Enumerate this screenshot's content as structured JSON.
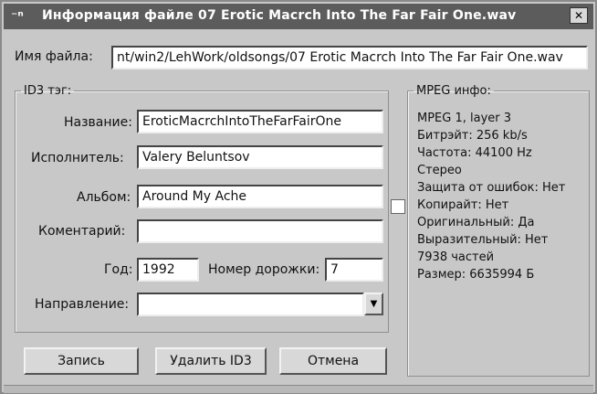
{
  "window": {
    "title": "Информация   файле   07 Erotic Macrch Into The Far Fair One.wav",
    "menu_icon": "menu-glyph",
    "close_icon": "close-icon"
  },
  "file": {
    "label": "Имя файла:",
    "value": "nt/win2/LehWork/oldsongs/07 Erotic Macrch Into The Far Fair One.wav"
  },
  "id3": {
    "legend": "ID3 тэг:",
    "title_label": "Название:",
    "title_value": "EroticMacrchIntoTheFarFairOne",
    "artist_label": "Исполнитель:",
    "artist_value": "Valery Beluntsov",
    "album_label": "Альбом:",
    "album_value": "Around My Ache",
    "comment_label": "Коментарий:",
    "comment_value": "",
    "year_label": "Год:",
    "year_value": "1992",
    "track_label": "Номер дорожки:",
    "track_value": "7",
    "genre_label": "Направление:",
    "genre_value": "",
    "dropdown_icon": "chevron-down-icon"
  },
  "mpeg": {
    "legend": "MPEG инфо:",
    "lines": [
      "MPEG 1, layer 3",
      "Битрэйт: 256 kb/s",
      "Частота: 44100 Hz",
      "Стерео",
      "Защита от ошибок: Нет",
      "Копирайт: Нет",
      "Оригинальный: Да",
      "Выразительный: Нет",
      "7938 частей",
      "Размер: 6635994 Б"
    ]
  },
  "buttons": {
    "write": "Запись",
    "delete_id3": "Удалить ID3",
    "cancel": "Отмена"
  }
}
